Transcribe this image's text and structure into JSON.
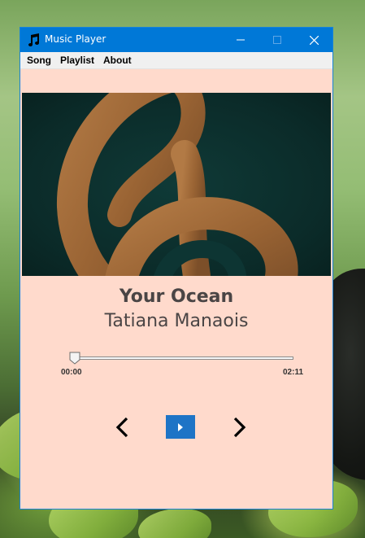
{
  "window": {
    "title": "Music Player",
    "accent_color": "#0078d7",
    "background_color": "#ffdacc"
  },
  "menu": {
    "items": [
      {
        "label": "Song"
      },
      {
        "label": "Playlist"
      },
      {
        "label": "About"
      }
    ]
  },
  "now_playing": {
    "title": "Your Ocean",
    "artist": "Tatiana Manaois",
    "album_art_icon": "treble-clef"
  },
  "progress": {
    "current_time": "00:00",
    "total_time": "02:11",
    "fraction": 0.0
  },
  "controls": {
    "previous_icon": "chevron-left-icon",
    "play_icon": "play-icon",
    "next_icon": "chevron-right-icon"
  }
}
